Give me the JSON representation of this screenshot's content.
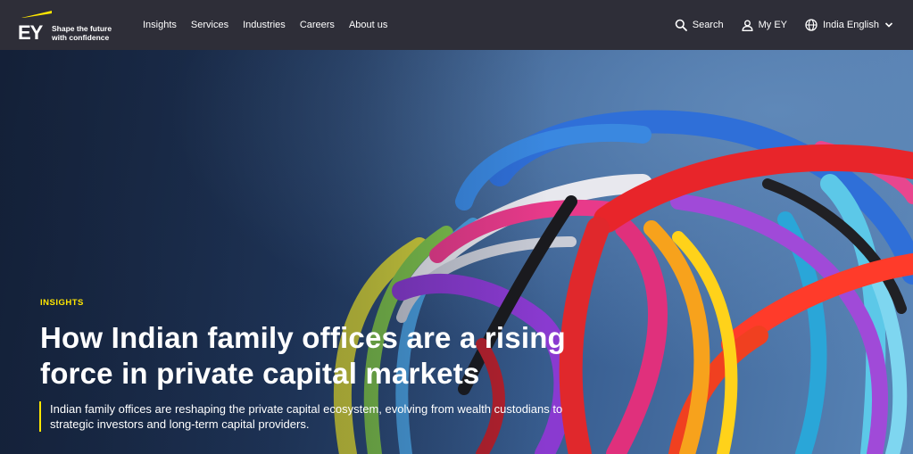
{
  "brand": {
    "logo_text": "EY",
    "tagline_line1": "Shape the future",
    "tagline_line2": "with confidence",
    "accent_color": "#ffe600",
    "header_color": "#2e2e38"
  },
  "nav": {
    "items": [
      {
        "label": "Insights"
      },
      {
        "label": "Services"
      },
      {
        "label": "Industries"
      },
      {
        "label": "Careers"
      },
      {
        "label": "About us"
      }
    ]
  },
  "utility": {
    "search_label": "Search",
    "search_icon": "search-icon",
    "account_label": "My EY",
    "account_icon": "user-icon",
    "locale_label": "India English",
    "locale_icon": "globe-icon",
    "locale_chevron": "chevron-down-icon"
  },
  "hero": {
    "eyebrow": "INSIGHTS",
    "headline_line1": "How Indian family offices are a rising",
    "headline_line2": "force in private capital markets",
    "summary_line1": "Indian family offices are reshaping the private capital ecosystem, evolving from wealth custodians to",
    "summary_line2": "strategic investors and long-term capital providers."
  }
}
